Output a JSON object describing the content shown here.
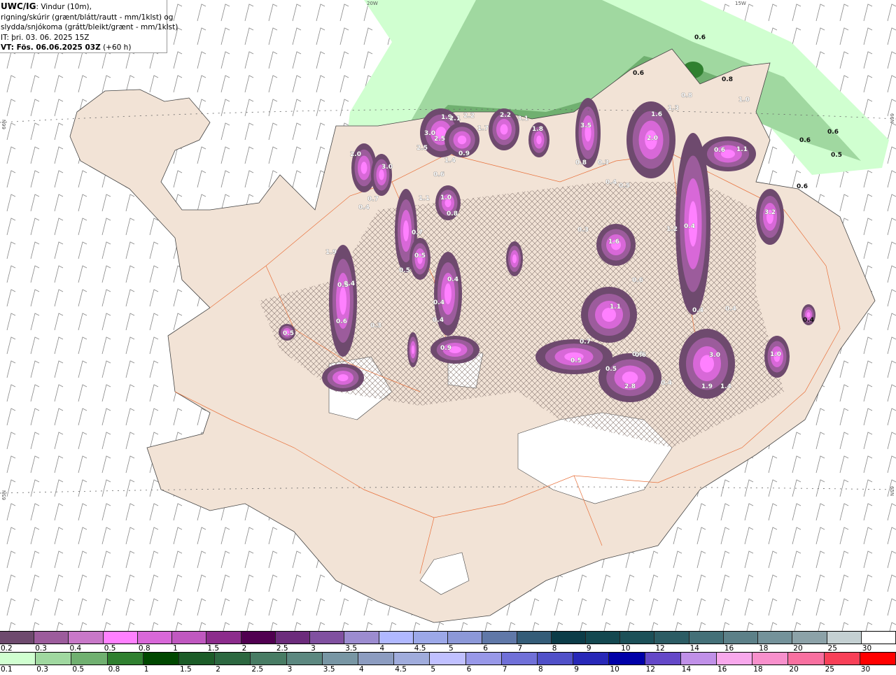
{
  "title": {
    "model": "UWC/IG",
    "line1": ": Vindur (10m),",
    "line2": "rigning/skúrir (grænt/blátt/rautt - mm/1klst) og",
    "line3": "slydda/snjókoma (grátt/bleikt/grænt - mm/1klst)",
    "init_time": "IT: þri. 03. 06. 2025 15Z",
    "valid_time": "VT: Fös. 06.06.2025 03Z",
    "lead": " (+60 h)"
  },
  "graticule": {
    "top": [
      "20W",
      "15W"
    ],
    "left": [
      "66N",
      "65N"
    ],
    "right": [
      "66N",
      "65N"
    ]
  },
  "map_labels": [
    "0.6",
    "0.6",
    "0.8",
    "1.0",
    "0.8",
    "0.6",
    "0.6",
    "0.5",
    "0.6",
    "1.6",
    "1.3",
    "2.0",
    "0.6",
    "1.1",
    "3.5",
    "0.8",
    "0.3",
    "0.4",
    "0.5",
    "3.2",
    "2.2",
    "3.1",
    "1.8",
    "1.9",
    "2.1",
    "2.2",
    "1.7",
    "3.0",
    "2.5",
    "2.5",
    "1.4",
    "0.9",
    "0.6",
    "2.0",
    "3.0",
    "0.7",
    "0.4",
    "1.1",
    "1.0",
    "0.8",
    "0.7",
    "0.5",
    "0.5",
    "1.9",
    "0.4",
    "0.6",
    "0.4",
    "0.4",
    "0.9",
    "0.4",
    "0.3",
    "0.5",
    "1.6",
    "0.6",
    "1.1",
    "0.7",
    "0.5",
    "0.6",
    "0.5",
    "2.8",
    "0.6",
    "0.4",
    "3.0",
    "1.9",
    "1.4",
    "1.0",
    "0.4",
    "0.4",
    "0.4",
    "0.5",
    "1.2",
    "0.3",
    "0.4"
  ],
  "colors": {
    "land": "#f2e3d6",
    "sea": "#ffffff",
    "roads": "#e8703a",
    "snow_scale": [
      "#6e4a6e",
      "#9c5c9c",
      "#c878c8",
      "#ff80ff",
      "#d868d8",
      "#c058c0",
      "#8c2c8c",
      "#500050",
      "#6c2c7c",
      "#8050a0",
      "#9c8cd0",
      "#b0b8ff",
      "#9ca8e8",
      "#8c98d8",
      "#6078a8",
      "#345c78",
      "#0c3c48",
      "#144850",
      "#1c5058",
      "#2c5c64",
      "#447078",
      "#5c8088",
      "#74929a",
      "#8ca2a8",
      "#c4d0d2",
      "#ffffff"
    ],
    "rain_scale": [
      "#d0ffd0",
      "#a0d8a0",
      "#70b070",
      "#308030",
      "#004800",
      "#1c5c28",
      "#2c6840",
      "#487c64",
      "#5c8880",
      "#7896a4",
      "#8c9cc0",
      "#a0acdc",
      "#c0c0ff",
      "#9898e8",
      "#7070d8",
      "#5050c8",
      "#2828b8",
      "#0000a8",
      "#6448c8",
      "#c090e8",
      "#f8a8ec",
      "#f890cc",
      "#f870a0",
      "#f84058",
      "#ff0000"
    ]
  },
  "legend": {
    "snow_labels": [
      "0.2",
      "0.3",
      "0.4",
      "0.5",
      "0.8",
      "1",
      "1.5",
      "2",
      "2.5",
      "3",
      "3.5",
      "4",
      "4.5",
      "5",
      "6",
      "7",
      "8",
      "9",
      "10",
      "12",
      "14",
      "16",
      "18",
      "20",
      "25",
      "30"
    ],
    "rain_labels": [
      "0.1",
      "0.3",
      "0.5",
      "0.8",
      "1",
      "1.5",
      "2",
      "2.5",
      "3",
      "3.5",
      "4",
      "4.5",
      "5",
      "6",
      "7",
      "8",
      "9",
      "10",
      "12",
      "14",
      "16",
      "18",
      "20",
      "25",
      "30"
    ]
  }
}
